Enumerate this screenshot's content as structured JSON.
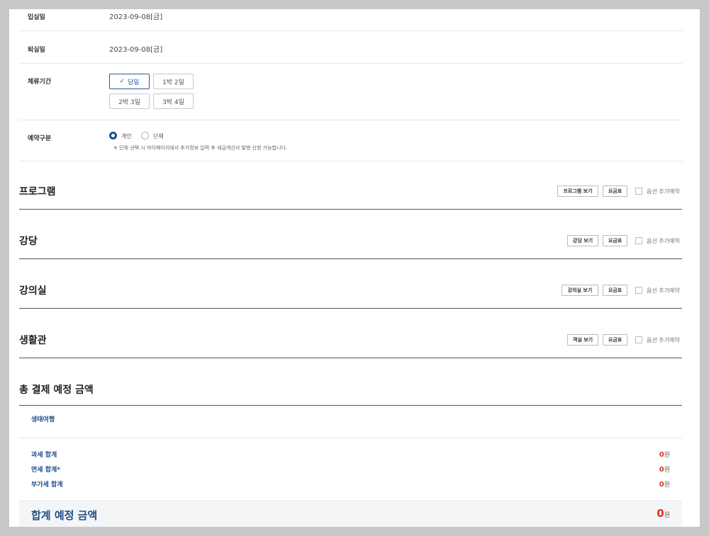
{
  "checkin": {
    "label": "입실일",
    "value": "2023-09-08[금]"
  },
  "checkout": {
    "label": "퇴실일",
    "value": "2023-09-08[금]"
  },
  "stay": {
    "label": "체류기간",
    "check_glyph": "✓",
    "options": [
      "당일",
      "1박 2일",
      "2박 3일",
      "3박 4일"
    ],
    "selected": "당일"
  },
  "reservation_type": {
    "label": "예약구분",
    "options": [
      "개인",
      "단체"
    ],
    "selected": "개인",
    "notice": "※ 단체 선택 시 마이페이지에서 추가정보 입력 후 세금계산서 발행 신청 가능합니다."
  },
  "sections": [
    {
      "title": "프로그램",
      "view_button": "프로그램 보기",
      "fee_button": "요금표",
      "option_label": "옵션 추가예약"
    },
    {
      "title": "강당",
      "view_button": "강당 보기",
      "fee_button": "요금표",
      "option_label": "옵션 추가예약"
    },
    {
      "title": "강의실",
      "view_button": "강의실 보기",
      "fee_button": "요금표",
      "option_label": "옵션 추가예약"
    },
    {
      "title": "생활관",
      "view_button": "객실 보기",
      "fee_button": "요금표",
      "option_label": "옵션 추가예약"
    }
  ],
  "total": {
    "title": "총 결제 예정 금액",
    "tour": "생태여행",
    "rows": [
      {
        "label": "과세 합계",
        "value": "0",
        "unit": "원"
      },
      {
        "label": "면세 합계*",
        "value": "0",
        "unit": "원"
      },
      {
        "label": "부가세 합계",
        "value": "0",
        "unit": "원"
      }
    ],
    "grand_label": "합계 예정 금액",
    "grand_value": "0",
    "grand_unit": "원"
  },
  "colors": {
    "accent": "#1f4e8a",
    "amount": "#e0301e",
    "background": "#c8c8c8"
  }
}
